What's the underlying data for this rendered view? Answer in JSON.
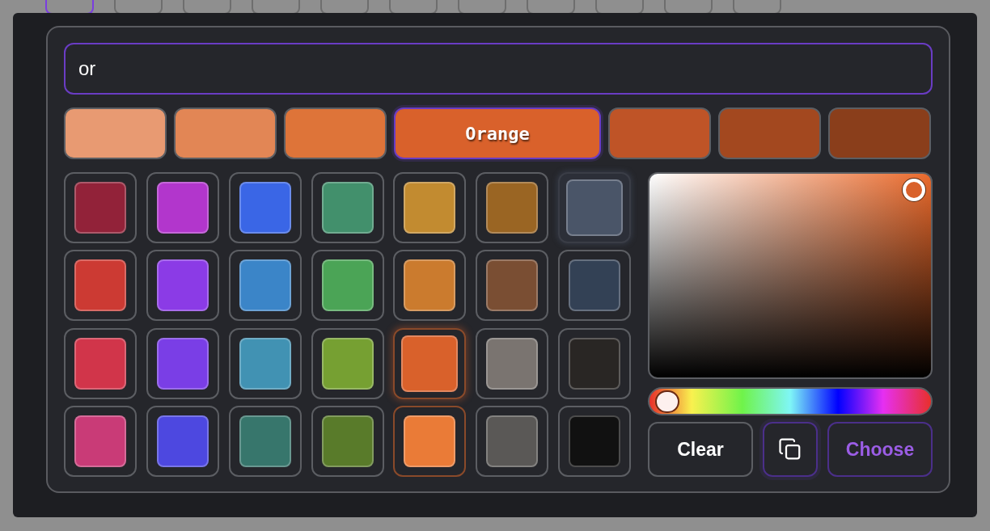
{
  "background_tabs": [
    {
      "selected": true
    },
    {
      "selected": false
    },
    {
      "selected": false
    },
    {
      "selected": false
    },
    {
      "selected": false
    },
    {
      "selected": false
    },
    {
      "selected": false
    },
    {
      "selected": false
    },
    {
      "selected": false
    },
    {
      "selected": false
    },
    {
      "selected": false
    }
  ],
  "search": {
    "value": "or"
  },
  "shades": [
    {
      "color": "#e89a72",
      "selected": false
    },
    {
      "color": "#e28655",
      "selected": false
    },
    {
      "color": "#de7439",
      "selected": false
    },
    {
      "color": "#d9612b",
      "selected": true,
      "label": "Orange"
    },
    {
      "color": "#bf5427",
      "selected": false
    },
    {
      "color": "#a3481f",
      "selected": false
    },
    {
      "color": "#8a3e1b",
      "selected": false
    }
  ],
  "swatches": [
    {
      "color": "#922239",
      "selected": false,
      "hovered": false,
      "related": false
    },
    {
      "color": "#b236cc",
      "selected": false,
      "hovered": false,
      "related": false
    },
    {
      "color": "#3a66e6",
      "selected": false,
      "hovered": false,
      "related": false
    },
    {
      "color": "#42906c",
      "selected": false,
      "hovered": false,
      "related": false
    },
    {
      "color": "#c28b30",
      "selected": false,
      "hovered": false,
      "related": false
    },
    {
      "color": "#9a6523",
      "selected": false,
      "hovered": false,
      "related": false
    },
    {
      "color": "#4a5568",
      "selected": false,
      "hovered": true,
      "related": false
    },
    {
      "color": "#cc3a33",
      "selected": false,
      "hovered": false,
      "related": false
    },
    {
      "color": "#8b3be6",
      "selected": false,
      "hovered": false,
      "related": false
    },
    {
      "color": "#3b85c8",
      "selected": false,
      "hovered": false,
      "related": false
    },
    {
      "color": "#4ba456",
      "selected": false,
      "hovered": false,
      "related": false
    },
    {
      "color": "#cb7b2e",
      "selected": false,
      "hovered": false,
      "related": false
    },
    {
      "color": "#7a4e33",
      "selected": false,
      "hovered": false,
      "related": false
    },
    {
      "color": "#334155",
      "selected": false,
      "hovered": false,
      "related": false
    },
    {
      "color": "#d1354a",
      "selected": false,
      "hovered": false,
      "related": false
    },
    {
      "color": "#7a3ee6",
      "selected": false,
      "hovered": false,
      "related": false
    },
    {
      "color": "#4192b3",
      "selected": false,
      "hovered": false,
      "related": false
    },
    {
      "color": "#76a032",
      "selected": false,
      "hovered": false,
      "related": false
    },
    {
      "color": "#d9612b",
      "selected": true,
      "hovered": false,
      "related": false
    },
    {
      "color": "#7a7470",
      "selected": false,
      "hovered": false,
      "related": false
    },
    {
      "color": "#292624",
      "selected": false,
      "hovered": false,
      "related": false
    },
    {
      "color": "#c93b77",
      "selected": false,
      "hovered": false,
      "related": false
    },
    {
      "color": "#4d48e0",
      "selected": false,
      "hovered": false,
      "related": false
    },
    {
      "color": "#37766c",
      "selected": false,
      "hovered": false,
      "related": false
    },
    {
      "color": "#597b2a",
      "selected": false,
      "hovered": false,
      "related": false
    },
    {
      "color": "#ea7b37",
      "selected": false,
      "hovered": false,
      "related": true
    },
    {
      "color": "#5a5856",
      "selected": false,
      "hovered": false,
      "related": false
    },
    {
      "color": "#111111",
      "selected": false,
      "hovered": false,
      "related": false
    }
  ],
  "picker": {
    "saturation": {
      "level": 0.94
    },
    "brightness": {
      "level": 0.92
    },
    "hue": {
      "level": 0.02
    }
  },
  "buttons": [
    {
      "kind": "text",
      "label": "Clear"
    },
    {
      "kind": "copy"
    },
    {
      "kind": "primary",
      "label": "Choose"
    }
  ]
}
